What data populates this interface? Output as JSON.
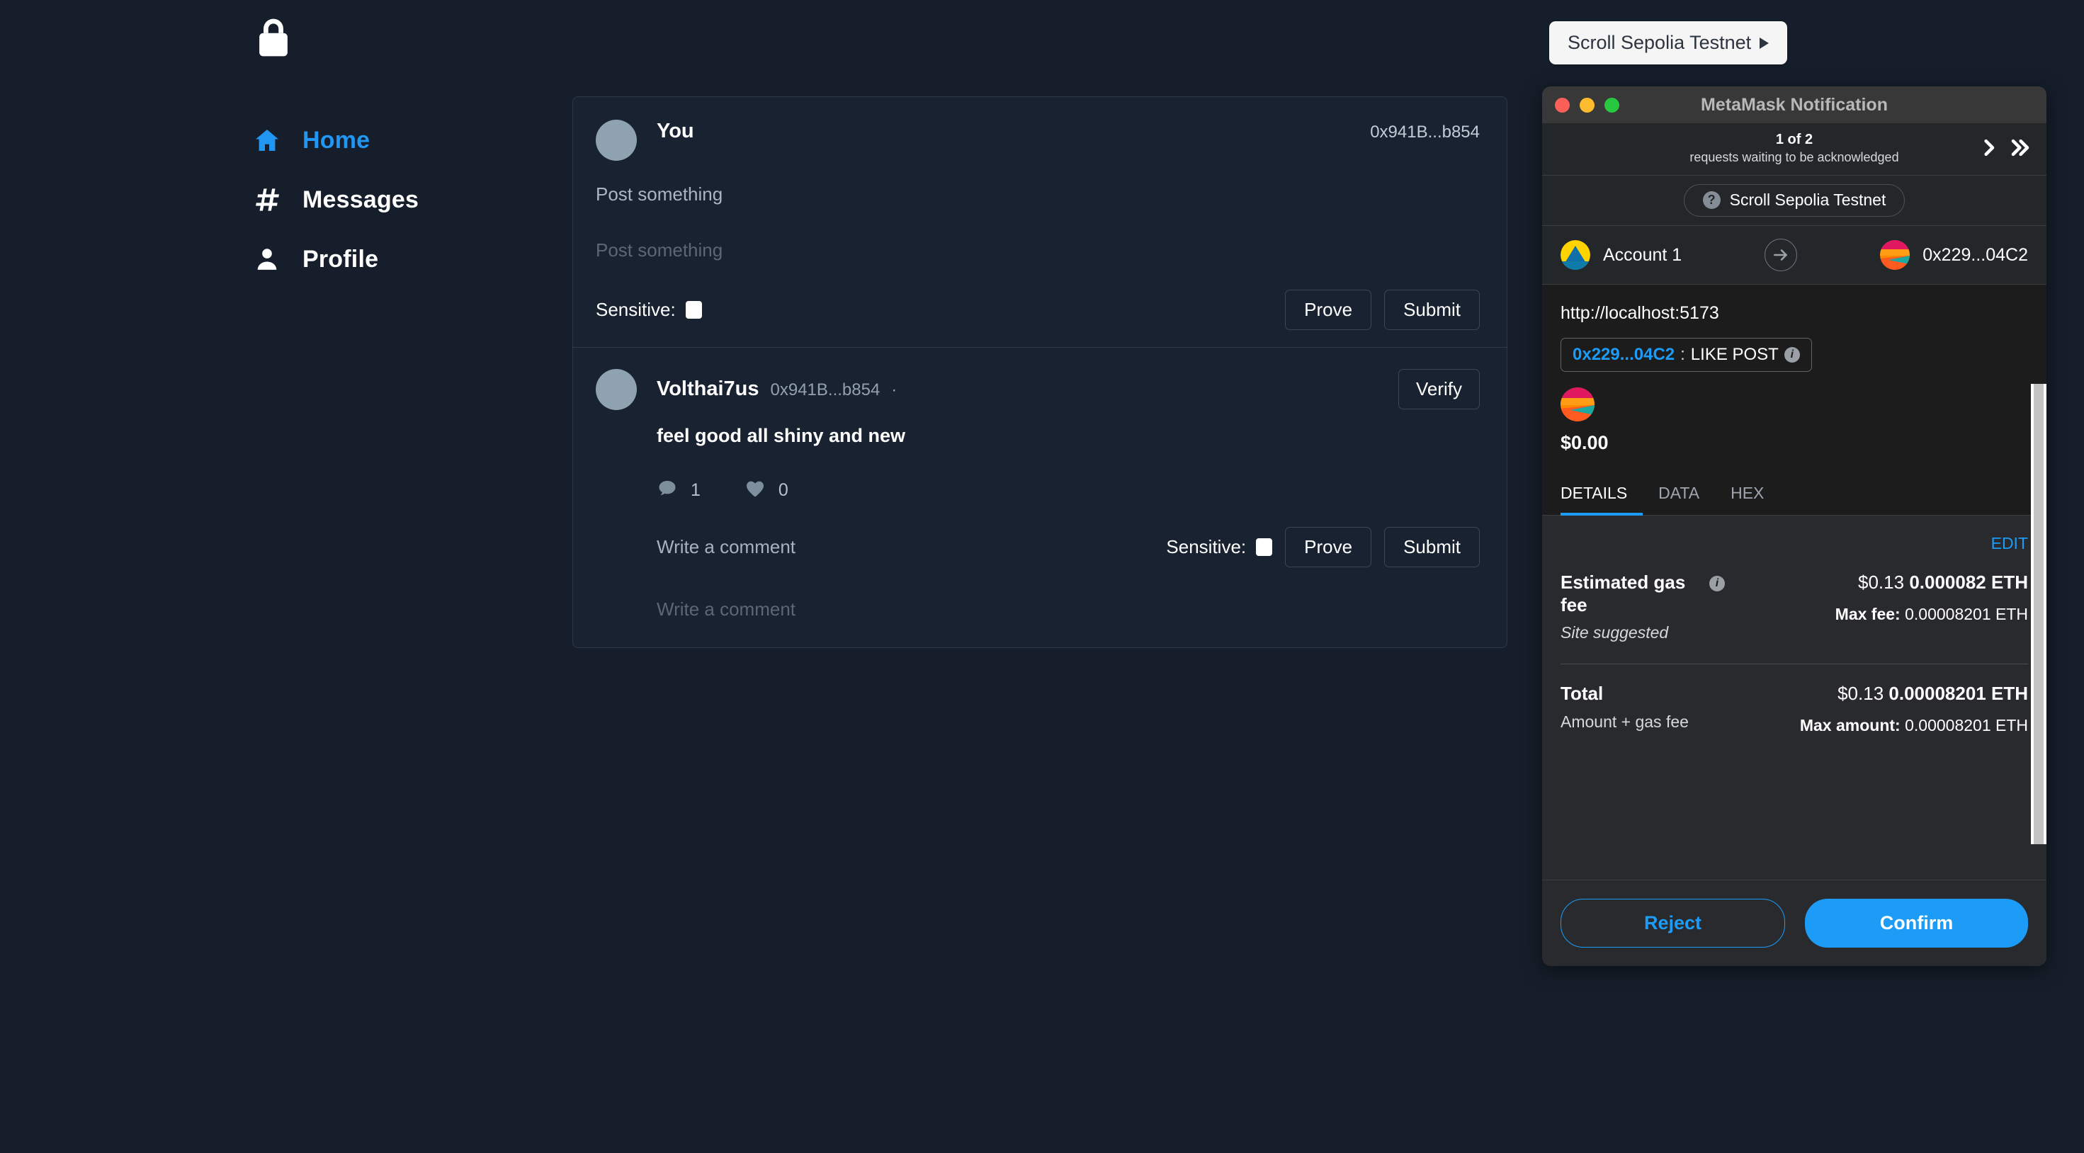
{
  "sidebar": {
    "logo_icon": "lock-icon",
    "items": [
      {
        "label": "Home",
        "icon": "home-icon",
        "active": true
      },
      {
        "label": "Messages",
        "icon": "hash-icon",
        "active": false
      },
      {
        "label": "Profile",
        "icon": "person-icon",
        "active": false
      }
    ]
  },
  "network_pill": {
    "label": "Scroll Sepolia Testnet",
    "icon": "play-triangle-icon"
  },
  "feed": {
    "composer": {
      "author": "You",
      "address": "0x941B...b854",
      "value": "Post something",
      "placeholder": "Post something",
      "sensitive_label": "Sensitive:",
      "prove_label": "Prove",
      "submit_label": "Submit"
    },
    "post": {
      "author": "Volthai7us",
      "address": "0x941B...b854",
      "separator": "·",
      "verify_label": "Verify",
      "text": "feel good all shiny and new",
      "comment_count": "1",
      "like_count": "0",
      "comment_value": "Write a comment",
      "comment_placeholder": "Write a comment",
      "sensitive_label": "Sensitive:",
      "prove_label": "Prove",
      "submit_label": "Submit"
    }
  },
  "metamask": {
    "window_title": "MetaMask Notification",
    "requests": {
      "count": "1 of 2",
      "subtitle": "requests waiting to be acknowledged",
      "next_icon": "chevron-right-icon",
      "last_icon": "chevron-double-right-icon"
    },
    "network": {
      "label": "Scroll Sepolia Testnet",
      "icon": "question-mark-icon"
    },
    "accounts": {
      "from_name": "Account 1",
      "from_icon": "account-identicon",
      "arrow_icon": "arrow-right-icon",
      "to_address": "0x229...04C2",
      "to_icon": "contract-identicon"
    },
    "transaction": {
      "origin": "http://localhost:5173",
      "contract_address": "0x229...04C2",
      "method_separator": ":",
      "method": "LIKE POST",
      "info_icon": "info-icon",
      "amount_icon": "contract-identicon",
      "amount_usd": "$0.00"
    },
    "tabs": [
      {
        "label": "DETAILS",
        "active": true
      },
      {
        "label": "DATA",
        "active": false
      },
      {
        "label": "HEX",
        "active": false
      }
    ],
    "details": {
      "edit_label": "EDIT",
      "gas": {
        "title": "Estimated gas fee",
        "subtitle": "Site suggested",
        "fiat": "$0.13",
        "eth": "0.000082 ETH",
        "max_label": "Max fee:",
        "max_value": "0.00008201 ETH"
      },
      "total": {
        "title": "Total",
        "subtitle": "Amount + gas fee",
        "fiat": "$0.13",
        "eth": "0.00008201 ETH",
        "max_label": "Max amount:",
        "max_value": "0.00008201 ETH"
      }
    },
    "footer": {
      "reject_label": "Reject",
      "confirm_label": "Confirm"
    }
  },
  "colors": {
    "page_bg": "#151e2a",
    "card_bg": "#182230",
    "accent_blue": "#1c9cf7",
    "nav_active": "#2196f3",
    "mm_bg": "#1c1c1c",
    "mm_panel": "#292a2d",
    "mm_header": "#24272a",
    "titlebar": "#383838"
  }
}
